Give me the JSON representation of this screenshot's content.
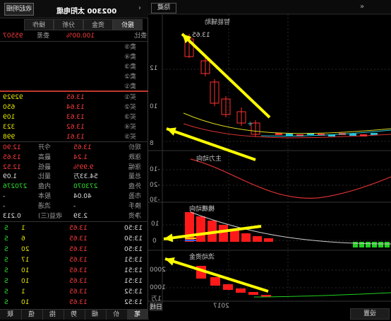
{
  "quote_panel": {
    "header": {
      "title": "002300 太阳电缆",
      "button": "收起明细",
      "back_icon": "back-arrow-icon"
    },
    "tabs": [
      "报价",
      "资金",
      "分析",
      "操作"
    ],
    "commission": {
      "ratio_label": "委比",
      "ratio_value": "100.00%",
      "diff_label": "委差",
      "diff_value": "95507"
    },
    "sell_rows": [
      {
        "label": "卖⑤",
        "price": "",
        "vol": ""
      },
      {
        "label": "卖④",
        "price": "",
        "vol": ""
      },
      {
        "label": "卖③",
        "price": "",
        "vol": ""
      },
      {
        "label": "卖②",
        "price": "",
        "vol": ""
      },
      {
        "label": "卖①",
        "price": "",
        "vol": ""
      }
    ],
    "buy_rows": [
      {
        "label": "买①",
        "price": "13.65",
        "vol": "92929"
      },
      {
        "label": "买②",
        "price": "13.64",
        "vol": "650"
      },
      {
        "label": "买③",
        "price": "13.63",
        "vol": "109"
      },
      {
        "label": "买④",
        "price": "13.62",
        "vol": "323"
      },
      {
        "label": "买⑤",
        "price": "13.61",
        "vol": "998"
      }
    ],
    "stats": [
      {
        "l1": "现价",
        "v1": "13.65",
        "l2": "今开",
        "v2": "12.90"
      },
      {
        "l1": "涨跌",
        "v1": "1.24",
        "l2": "最高",
        "v2": "13.65"
      },
      {
        "l1": "涨幅",
        "v1": "9.99%",
        "l2": "最低",
        "v2": "12.52"
      },
      {
        "l1": "总量",
        "v1": "54.33万",
        "l2": "量比",
        "v2": "1.09"
      },
      {
        "l1": "外盘",
        "v1": "273070",
        "l2": "内盘",
        "v2": "270276"
      },
      {
        "l1": "市盈",
        "v1": "40.04",
        "l2": "股本",
        "v2": "-"
      },
      {
        "l1": "换手",
        "v1": "-",
        "l2": "流通",
        "v2": "-"
      },
      {
        "l1": "净资",
        "v1": "2.39",
        "l2": "收益(三)",
        "v2": "0.213"
      }
    ],
    "ticks": [
      {
        "time": "13:50",
        "price": "13.65",
        "vol": "1",
        "flag": "S"
      },
      {
        "time": "13:50",
        "price": "13.65",
        "vol": "6",
        "flag": "S"
      },
      {
        "time": "13:50",
        "price": "13.65",
        "vol": "20",
        "flag": "S"
      },
      {
        "time": "13:51",
        "price": "13.65",
        "vol": "17",
        "flag": "S"
      },
      {
        "time": "13:51",
        "price": "13.65",
        "vol": "10",
        "flag": "S"
      },
      {
        "time": "13:51",
        "price": "13.65",
        "vol": "10",
        "flag": "S"
      },
      {
        "time": "13:52",
        "price": "13.65",
        "vol": "1",
        "flag": "S"
      },
      {
        "time": "13:52",
        "price": "13.65",
        "vol": "10",
        "flag": "S"
      }
    ],
    "bottom_tabs": [
      "笔",
      "价",
      "细",
      "势",
      "指",
      "值",
      "联"
    ]
  },
  "chart_area": {
    "top_button": "隐藏",
    "main_label": "智能辅助",
    "price_label_top": "13.65",
    "y_axis_main": [
      "12",
      "10",
      "8"
    ],
    "indicator1_label": "主力动向",
    "indicator1_axis": [
      "-10",
      "-20",
      "-30"
    ],
    "indicator2_label": "機構动向",
    "indicator2_axis": [
      "10",
      "0"
    ],
    "indicator3_label": "流动资金",
    "indicator3_axis": [
      "2000",
      "1000"
    ],
    "x_label": "2017",
    "bottom_left": "日线",
    "bottom_right": "设置",
    "vol_label": "1万"
  }
}
